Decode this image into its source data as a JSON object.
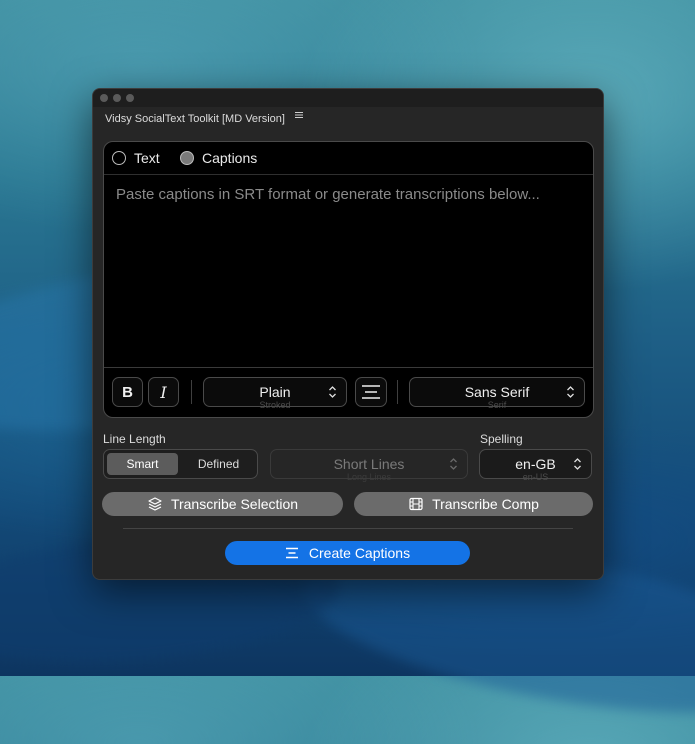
{
  "panel": {
    "title": "Vidsy SocialText Toolkit [MD Version]",
    "menu_icon": "hamburger-menu-icon"
  },
  "mode": {
    "options": [
      {
        "label": "Text",
        "selected": false
      },
      {
        "label": "Captions",
        "selected": true
      }
    ]
  },
  "editor": {
    "placeholder": "Paste captions in SRT format or generate transcriptions below...",
    "value": ""
  },
  "toolbar": {
    "bold_label": "B",
    "italic_label": "I",
    "style": {
      "selected": "Plain",
      "next_option": "Stroked"
    },
    "align_icon": "align-center-icon",
    "font": {
      "selected": "Sans Serif",
      "next_option": "Serif"
    }
  },
  "line_length": {
    "label": "Line Length",
    "options": [
      "Smart",
      "Defined"
    ],
    "selected": "Smart",
    "lines_select": {
      "selected": "Short Lines",
      "next_option": "Long Lines",
      "disabled": true
    }
  },
  "spelling": {
    "label": "Spelling",
    "selected": "en-GB",
    "next_option": "en-US"
  },
  "actions": {
    "transcribe_selection": "Transcribe Selection",
    "transcribe_comp": "Transcribe Comp",
    "create_captions": "Create Captions"
  },
  "colors": {
    "panel_bg": "#262626",
    "editor_bg": "#000000",
    "accent": "#1473e6",
    "secondary_button": "#6b6b6b"
  }
}
